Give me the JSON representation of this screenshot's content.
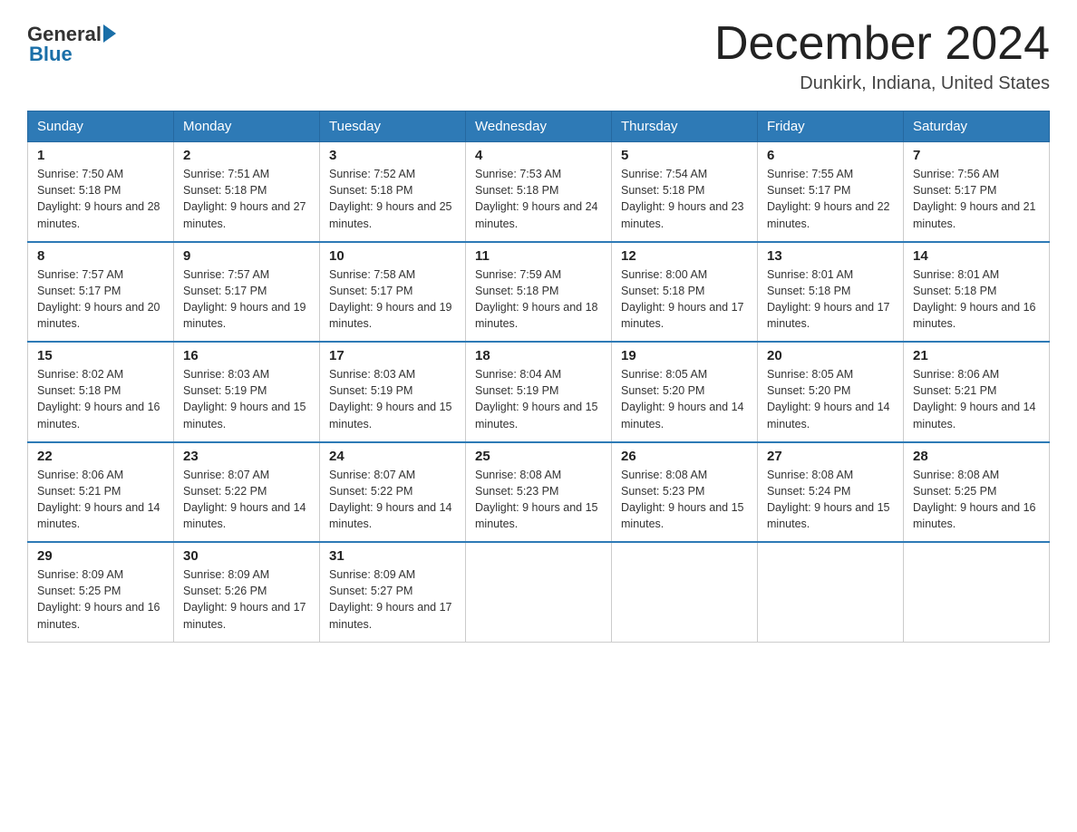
{
  "header": {
    "title": "December 2024",
    "location": "Dunkirk, Indiana, United States",
    "logo_general": "General",
    "logo_blue": "Blue"
  },
  "days_of_week": [
    "Sunday",
    "Monday",
    "Tuesday",
    "Wednesday",
    "Thursday",
    "Friday",
    "Saturday"
  ],
  "weeks": [
    [
      {
        "day": "1",
        "sunrise": "7:50 AM",
        "sunset": "5:18 PM",
        "daylight": "9 hours and 28 minutes."
      },
      {
        "day": "2",
        "sunrise": "7:51 AM",
        "sunset": "5:18 PM",
        "daylight": "9 hours and 27 minutes."
      },
      {
        "day": "3",
        "sunrise": "7:52 AM",
        "sunset": "5:18 PM",
        "daylight": "9 hours and 25 minutes."
      },
      {
        "day": "4",
        "sunrise": "7:53 AM",
        "sunset": "5:18 PM",
        "daylight": "9 hours and 24 minutes."
      },
      {
        "day": "5",
        "sunrise": "7:54 AM",
        "sunset": "5:18 PM",
        "daylight": "9 hours and 23 minutes."
      },
      {
        "day": "6",
        "sunrise": "7:55 AM",
        "sunset": "5:17 PM",
        "daylight": "9 hours and 22 minutes."
      },
      {
        "day": "7",
        "sunrise": "7:56 AM",
        "sunset": "5:17 PM",
        "daylight": "9 hours and 21 minutes."
      }
    ],
    [
      {
        "day": "8",
        "sunrise": "7:57 AM",
        "sunset": "5:17 PM",
        "daylight": "9 hours and 20 minutes."
      },
      {
        "day": "9",
        "sunrise": "7:57 AM",
        "sunset": "5:17 PM",
        "daylight": "9 hours and 19 minutes."
      },
      {
        "day": "10",
        "sunrise": "7:58 AM",
        "sunset": "5:17 PM",
        "daylight": "9 hours and 19 minutes."
      },
      {
        "day": "11",
        "sunrise": "7:59 AM",
        "sunset": "5:18 PM",
        "daylight": "9 hours and 18 minutes."
      },
      {
        "day": "12",
        "sunrise": "8:00 AM",
        "sunset": "5:18 PM",
        "daylight": "9 hours and 17 minutes."
      },
      {
        "day": "13",
        "sunrise": "8:01 AM",
        "sunset": "5:18 PM",
        "daylight": "9 hours and 17 minutes."
      },
      {
        "day": "14",
        "sunrise": "8:01 AM",
        "sunset": "5:18 PM",
        "daylight": "9 hours and 16 minutes."
      }
    ],
    [
      {
        "day": "15",
        "sunrise": "8:02 AM",
        "sunset": "5:18 PM",
        "daylight": "9 hours and 16 minutes."
      },
      {
        "day": "16",
        "sunrise": "8:03 AM",
        "sunset": "5:19 PM",
        "daylight": "9 hours and 15 minutes."
      },
      {
        "day": "17",
        "sunrise": "8:03 AM",
        "sunset": "5:19 PM",
        "daylight": "9 hours and 15 minutes."
      },
      {
        "day": "18",
        "sunrise": "8:04 AM",
        "sunset": "5:19 PM",
        "daylight": "9 hours and 15 minutes."
      },
      {
        "day": "19",
        "sunrise": "8:05 AM",
        "sunset": "5:20 PM",
        "daylight": "9 hours and 14 minutes."
      },
      {
        "day": "20",
        "sunrise": "8:05 AM",
        "sunset": "5:20 PM",
        "daylight": "9 hours and 14 minutes."
      },
      {
        "day": "21",
        "sunrise": "8:06 AM",
        "sunset": "5:21 PM",
        "daylight": "9 hours and 14 minutes."
      }
    ],
    [
      {
        "day": "22",
        "sunrise": "8:06 AM",
        "sunset": "5:21 PM",
        "daylight": "9 hours and 14 minutes."
      },
      {
        "day": "23",
        "sunrise": "8:07 AM",
        "sunset": "5:22 PM",
        "daylight": "9 hours and 14 minutes."
      },
      {
        "day": "24",
        "sunrise": "8:07 AM",
        "sunset": "5:22 PM",
        "daylight": "9 hours and 14 minutes."
      },
      {
        "day": "25",
        "sunrise": "8:08 AM",
        "sunset": "5:23 PM",
        "daylight": "9 hours and 15 minutes."
      },
      {
        "day": "26",
        "sunrise": "8:08 AM",
        "sunset": "5:23 PM",
        "daylight": "9 hours and 15 minutes."
      },
      {
        "day": "27",
        "sunrise": "8:08 AM",
        "sunset": "5:24 PM",
        "daylight": "9 hours and 15 minutes."
      },
      {
        "day": "28",
        "sunrise": "8:08 AM",
        "sunset": "5:25 PM",
        "daylight": "9 hours and 16 minutes."
      }
    ],
    [
      {
        "day": "29",
        "sunrise": "8:09 AM",
        "sunset": "5:25 PM",
        "daylight": "9 hours and 16 minutes."
      },
      {
        "day": "30",
        "sunrise": "8:09 AM",
        "sunset": "5:26 PM",
        "daylight": "9 hours and 17 minutes."
      },
      {
        "day": "31",
        "sunrise": "8:09 AM",
        "sunset": "5:27 PM",
        "daylight": "9 hours and 17 minutes."
      },
      null,
      null,
      null,
      null
    ]
  ]
}
